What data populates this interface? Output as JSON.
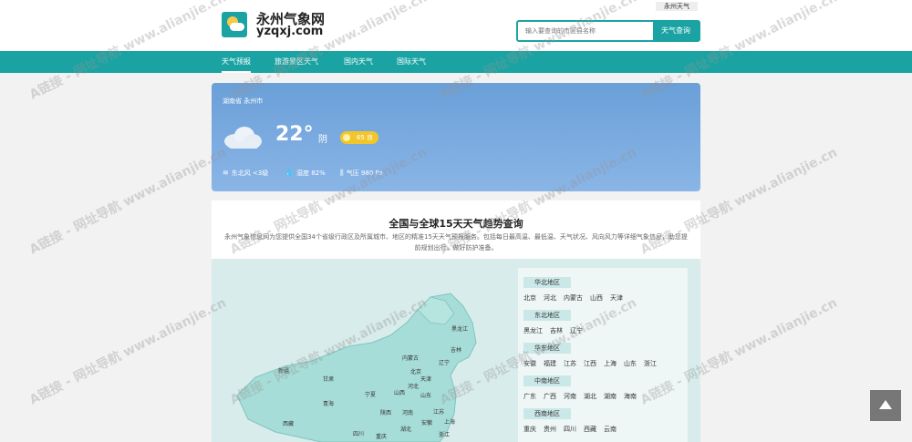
{
  "header": {
    "site_name": "永州气象网",
    "domain": "yzqxj.com",
    "corner_tag": "永州天气",
    "search_placeholder": "输入要查询的市区县名称",
    "search_button": "天气查询"
  },
  "nav": [
    {
      "label": "天气预报",
      "active": true
    },
    {
      "label": "旅游景区天气",
      "active": false
    },
    {
      "label": "国内天气",
      "active": false
    },
    {
      "label": "国际天气",
      "active": false
    }
  ],
  "weather": {
    "location": "湖南省 永州市",
    "temperature": "22°",
    "condition": "阴",
    "aqi": "65 良",
    "wind": "东北风 <3级",
    "humidity": "湿度 82%",
    "pressure": "气压 980 Pa"
  },
  "panel": {
    "title": "全国与全球15天天气趋势查询",
    "description": "永州气象信息网为您提供全国34个省级行政区及所属城市、地区的精准15天天气预报服务。包括每日最高温、最低温、天气状况、风向风力等详细气象信息，助您提前规划出行，做好防护准备。"
  },
  "map_labels": [
    "黑龙江",
    "吉林",
    "辽宁",
    "内蒙古",
    "北京",
    "天津",
    "河北",
    "山西",
    "山东",
    "宁夏",
    "甘肃",
    "新疆",
    "青海",
    "陕西",
    "河南",
    "江苏",
    "安徽",
    "上海",
    "湖北",
    "浙江",
    "西藏",
    "四川",
    "重庆"
  ],
  "regions": [
    {
      "name": "华北地区",
      "items": [
        "北京",
        "河北",
        "内蒙古",
        "山西",
        "天津"
      ]
    },
    {
      "name": "东北地区",
      "items": [
        "黑龙江",
        "吉林",
        "辽宁"
      ]
    },
    {
      "name": "华东地区",
      "items": [
        "安徽",
        "福建",
        "江苏",
        "江西",
        "上海",
        "山东",
        "浙江"
      ]
    },
    {
      "name": "中南地区",
      "items": [
        "广东",
        "广西",
        "河南",
        "湖北",
        "湖南",
        "海南"
      ]
    },
    {
      "name": "西南地区",
      "items": [
        "重庆",
        "贵州",
        "四川",
        "西藏",
        "云南"
      ]
    }
  ],
  "watermark": "A链接 - 网址导航 www.alianjie.cn",
  "colors": {
    "accent": "#1ba3a3",
    "weather_bg": "#7aaae0",
    "aqi_badge": "#f2c62a"
  },
  "icons": {
    "logo": "weather-logo-icon",
    "weather": "cloud-icon",
    "back_to_top": "arrow-up-icon"
  }
}
